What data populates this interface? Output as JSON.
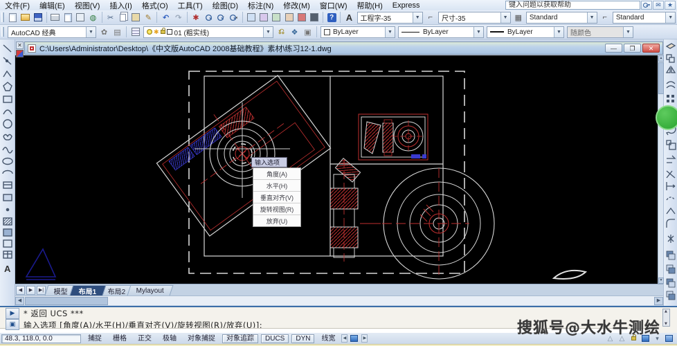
{
  "menu": {
    "items": [
      "文件(F)",
      "编辑(E)",
      "视图(V)",
      "插入(I)",
      "格式(O)",
      "工具(T)",
      "绘图(D)",
      "标注(N)",
      "修改(M)",
      "窗口(W)",
      "帮助(H)",
      "Express"
    ]
  },
  "help": {
    "placeholder": "键入问题以获取帮助"
  },
  "toolbars": {
    "workspace": "AutoCAD 经典",
    "layer": "01 (粗实线)",
    "color": "ByLayer",
    "linetype": "ByLayer",
    "lineweight": "ByLayer",
    "plot_style": "随颜色",
    "text_style": "工程字-35",
    "dim_style": "尺寸-35",
    "table_style": "Standard",
    "mleader_style": "Standard"
  },
  "document": {
    "title": "C:\\Users\\Administrator\\Desktop\\《中文版AutoCAD 2008基础教程》素材\\练习12-1.dwg"
  },
  "context_menu": {
    "header": "输入选项",
    "items": [
      "角度(A)",
      "水平(H)",
      "垂直对齐(V)",
      "旋转视图(R)",
      "放弃(U)"
    ]
  },
  "tabs": {
    "items": [
      "模型",
      "布局1",
      "布局2",
      "Mylayout"
    ],
    "active": "布局1"
  },
  "command": {
    "line1": "* 返回 UCS ***",
    "line2": "输入选项 [角度(A)/水平(H)/垂直对齐(V)/旋转视图(R)/放弃(U)]:"
  },
  "status": {
    "coords": "48.3, 118.0, 0.0",
    "toggles": [
      "捕捉",
      "栅格",
      "正交",
      "极轴",
      "对象捕捉",
      "对象追踪",
      "DUCS",
      "DYN",
      "线宽"
    ]
  },
  "watermark": {
    "text": "搜狐号@大水牛测绘"
  },
  "colors": {
    "chrome_blue": "#d6e2f2",
    "canvas_black": "#000000",
    "cad_red": "#c03030",
    "cad_white": "#d8d8d8",
    "cad_blue": "#3a3ad0",
    "badge_green": "#2eb135",
    "command_border_blue": "#3c6ea8"
  }
}
